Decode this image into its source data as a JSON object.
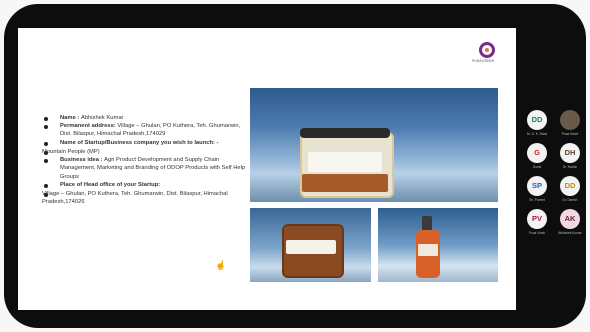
{
  "slide": {
    "logo_text": "PUSA KRISHI",
    "details": [
      {
        "label": "Name : ",
        "value": "Abhishek Kumar",
        "bullet": true
      },
      {
        "label": "Permanent address: ",
        "value": "Village – Ghulan, PO Kuthera, Teh. Ghumarwin, Dist. Bilaspur, Himachal Pradesh,174029",
        "bullet": true
      },
      {
        "label": "Name of Startup/Business company you wish to launch: -",
        "value": "",
        "bullet": true
      },
      {
        "label": "",
        "value": "Mountain People (MP)",
        "bullet": false
      },
      {
        "label": "Business idea : ",
        "value": "Agri Product Development and Supply Chain Management, Marketing and Branding of ODOP Products with Self Help Groups",
        "bullet": true
      },
      {
        "label": "Place of Head office of your Startup:",
        "value": "",
        "bullet": true
      },
      {
        "label": "",
        "value": "Village – Ghulan, PO Kuthera, Teh. Ghumarwin, Dist. Bilaspur, Himachal   Pradesh,174026",
        "bullet": false
      }
    ]
  },
  "participants": [
    {
      "initials": "DD",
      "name": "Dr. D. K. Ranu",
      "color": "#1a7f5a",
      "bg": "#f3f3f3"
    },
    {
      "initials": "",
      "name": "Pusa Krishi",
      "color": "#ffffff",
      "bg": "#6a5a4a"
    },
    {
      "initials": "G",
      "name": "Guest",
      "color": "#c62828",
      "bg": "#f3f3f3"
    },
    {
      "initials": "DH",
      "name": "Dr. Harish",
      "color": "#5d4037",
      "bg": "#f3f3f3"
    },
    {
      "initials": "SP",
      "name": "Sh. Puneet",
      "color": "#1565c0",
      "bg": "#f3f3f3"
    },
    {
      "initials": "DD",
      "name": "Dr. Dinesh",
      "color": "#c49000",
      "bg": "#f3f3f3"
    },
    {
      "initials": "PV",
      "name": "Pusa Vivek",
      "color": "#ad1457",
      "bg": "#f3f3f3"
    },
    {
      "initials": "AK",
      "name": "Abhishek Kumar",
      "color": "#6d1b3a",
      "bg": "#f0d9e2"
    }
  ],
  "colors": {
    "accent": "#7b2a8a",
    "frame": "#0d0d0d"
  }
}
